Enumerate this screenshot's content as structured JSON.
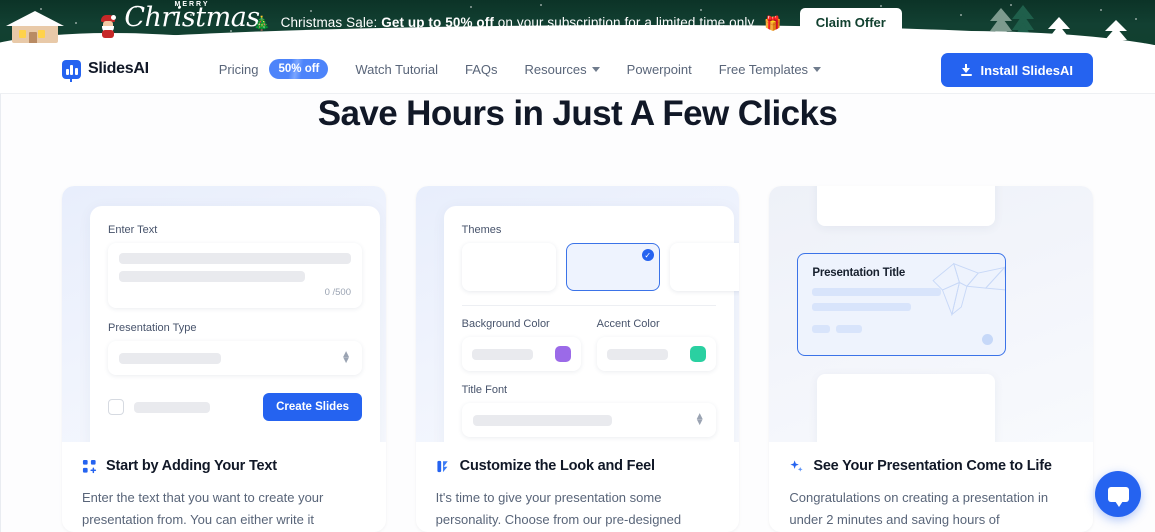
{
  "banner": {
    "merry_small": "MERRY",
    "merry_script": "Christmas",
    "tree_icon": "🎄",
    "text_prefix": "Christmas Sale: ",
    "text_bold": "Get up to 50% off",
    "text_suffix": " on your subscription for a limited time only ",
    "gift_icon": "🎁",
    "claim_label": "Claim Offer"
  },
  "nav": {
    "brand": "SlidesAI",
    "links": [
      {
        "label": "Pricing",
        "badge": "50% off",
        "caret": false
      },
      {
        "label": "Watch Tutorial",
        "caret": false
      },
      {
        "label": "FAQs",
        "caret": false
      },
      {
        "label": "Resources",
        "caret": true
      },
      {
        "label": "Powerpoint",
        "caret": false
      },
      {
        "label": "Free Templates",
        "caret": true
      }
    ],
    "install_label": "Install SlidesAI"
  },
  "hero": {
    "title": "Save Hours in Just A Few Clicks"
  },
  "cards": [
    {
      "title": "Start by Adding Your Text",
      "desc": "Enter the text that you want to create your presentation from. You can either write it",
      "icon": "dots-grid-icon",
      "form": {
        "enter_text_label": "Enter Text",
        "counter": "0 /500",
        "presentation_type_label": "Presentation Type",
        "create_button": "Create Slides"
      }
    },
    {
      "title": "Customize the Look and Feel",
      "desc": "It's time to give your presentation some personality. Choose from our pre-designed",
      "icon": "palette-icon",
      "form": {
        "themes_label": "Themes",
        "background_color_label": "Background Color",
        "accent_color_label": "Accent Color",
        "title_font_label": "Title Font",
        "background_swatch": "#9b6ae8",
        "accent_swatch": "#2ad0a1",
        "selected_theme_index": 1
      }
    },
    {
      "title": "See Your Presentation Come to Life",
      "desc": "Congratulations on creating a presentation in under 2 minutes and saving hours of",
      "icon": "sparkles-icon",
      "preview": {
        "slide_title": "Presentation Title"
      }
    }
  ],
  "chat": {
    "icon": "chat-bubble-icon"
  },
  "colors": {
    "brand_blue": "#2563f0",
    "banner_green": "#11402f",
    "text_dark": "#111827",
    "text_muted": "#596579"
  }
}
